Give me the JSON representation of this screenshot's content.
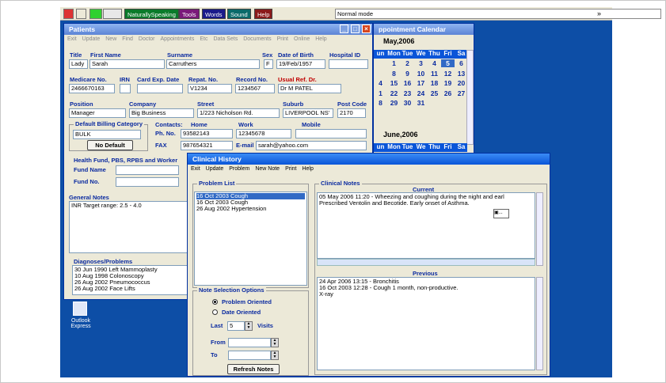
{
  "taskbar": {
    "naturallyspeaking": "NaturallySpeaking",
    "tools": "Tools",
    "words": "Words",
    "sound": "Sound",
    "help": "Help",
    "mode": "Normal mode"
  },
  "desktop": {
    "outlook_label_1": "Outlook",
    "outlook_label_2": "Express"
  },
  "patients": {
    "title": "Patients",
    "menu": [
      "Exit",
      "Update",
      "New",
      "Find",
      "Doctor",
      "Appointments",
      "Etc",
      "Data Sets",
      "Documents",
      "Print",
      "Online",
      "Help"
    ],
    "labels": {
      "title": "Title",
      "first": "First Name",
      "surname": "Surname",
      "sex": "Sex",
      "dob": "Date of Birth",
      "hospital": "Hospital ID",
      "medicare": "Medicare No.",
      "irn": "IRN",
      "cardexp": "Card Exp. Date",
      "repat": "Repat. No.",
      "record": "Record No.",
      "usualdr": "Usual Ref. Dr.",
      "position": "Position",
      "company": "Company",
      "street": "Street",
      "suburb": "Suburb",
      "postcode": "Post Code",
      "billing": "Default Billing Category",
      "contacts": "Contacts:",
      "home": "Home",
      "work": "Work",
      "mobile": "Mobile",
      "phno": "Ph. No.",
      "fax": "FAX",
      "email": "E-mail",
      "health": "Health Fund, PBS, RPBS and Worker",
      "fundname": "Fund Name",
      "fundno": "Fund No.",
      "notes": "General Notes",
      "diagnoses": "Diagnoses/Problems"
    },
    "values": {
      "title": "Lady",
      "first": "Sarah",
      "surname": "Carruthers",
      "sex": "F",
      "dob": "19/Feb/1957",
      "medicare": "2466670163",
      "repat": "V1234",
      "record": "1234567",
      "usualdr": "Dr M PATEL",
      "position": "Manager",
      "company": "Big Business",
      "street": "1/223  Nicholson Rd.",
      "suburb": "LIVERPOOL NS'",
      "postcode": "2170",
      "billing": "BULK",
      "phhome": "93582143",
      "phwork": "12345678",
      "fax": "987654321",
      "email": "sarah@yahoo.com",
      "notes": "INR Target range: 2.5 - 4.0"
    },
    "nodefault_label": "No Default",
    "diagnoses": [
      "30 Jun 1990  Left Mammoplasty",
      "10 Aug 1998  Colonoscopy",
      "26 Aug 2002  Pneumococcus",
      "26 Aug 2002  Face Lifts"
    ]
  },
  "calendar": {
    "title": "ppointment Calendar",
    "month1": "May,2006",
    "month2": "June,2006",
    "days": [
      "un",
      "Mon",
      "Tue",
      "We",
      "Thu",
      "Fri",
      "Sa"
    ],
    "rows": [
      [
        "",
        "1",
        "2",
        "3",
        "4",
        "5",
        "6"
      ],
      [
        "",
        "8",
        "9",
        "10",
        "11",
        "12",
        "13"
      ],
      [
        "4",
        "15",
        "16",
        "17",
        "18",
        "19",
        "20"
      ],
      [
        "1",
        "22",
        "23",
        "24",
        "25",
        "26",
        "27"
      ],
      [
        "8",
        "29",
        "30",
        "31",
        "",
        "",
        ""
      ]
    ]
  },
  "clinical": {
    "title": "Clinical History",
    "menu": [
      "Exit",
      "Update",
      "Problem",
      "New Note",
      "Print",
      "Help"
    ],
    "problem_list_label": "Problem List",
    "problems": [
      "16 Oct 2003   Cough",
      "16 Oct 2003   Cough",
      "26 Aug 2002   Hypertension"
    ],
    "clinical_notes_label": "Clinical Notes",
    "current_label": "Current",
    "current_notes": [
      "05 May 2006 11:20 - Wheezing and coughing during the night and earl",
      "Prescribed Ventolin and Becotide.  Early onset of Asthma."
    ],
    "previous_label": "Previous",
    "previous_notes": [
      "24 Apr 2006  13:15 - Bronchitis",
      "16 Oct 2003  12:28 - Cough 1 month, non-productive.",
      "X-ray"
    ],
    "options_label": "Note Selection Options",
    "problem_oriented": "Problem Oriented",
    "date_oriented": "Date Oriented",
    "last_label": "Last",
    "last_value": "5",
    "visits_label": "Visits",
    "from_label": "From",
    "to_label": "To",
    "refresh_label": "Refresh Notes"
  }
}
